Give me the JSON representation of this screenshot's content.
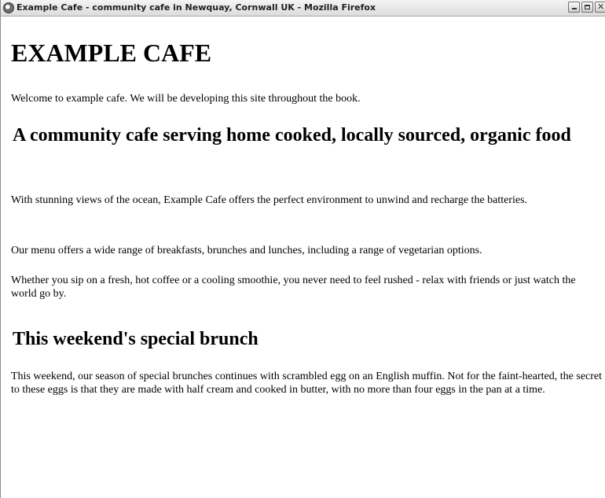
{
  "window": {
    "title": "Example Cafe - community cafe in Newquay, Cornwall UK - Mozilla Firefox",
    "icon": "firefox-globe-icon",
    "controls": {
      "minimize": "minimize-icon",
      "maximize": "maximize-icon",
      "close": "close-icon",
      "close_glyph": "✕"
    }
  },
  "page": {
    "site_title": "EXAMPLE CAFE",
    "welcome": "Welcome to example cafe. We will be developing this site throughout the book.",
    "heading1": "A community cafe serving home cooked, locally sourced, organic food",
    "para1": "With stunning views of the ocean, Example Cafe offers the perfect environment to unwind and recharge the batteries.",
    "para2": "Our menu offers a wide range of breakfasts, brunches and lunches, including a range of vegetarian options.",
    "para3": "Whether you sip on a fresh, hot coffee or a cooling smoothie, you never need to feel rushed - relax with friends or just watch the world go by.",
    "heading2": "This weekend's special brunch",
    "para4": "This weekend, our season of special brunches continues with scrambled egg on an English muffin. Not for the faint-hearted, the secret to these eggs is that they are made with half cream and cooked in butter, with no more than four eggs in the pan at a time."
  }
}
